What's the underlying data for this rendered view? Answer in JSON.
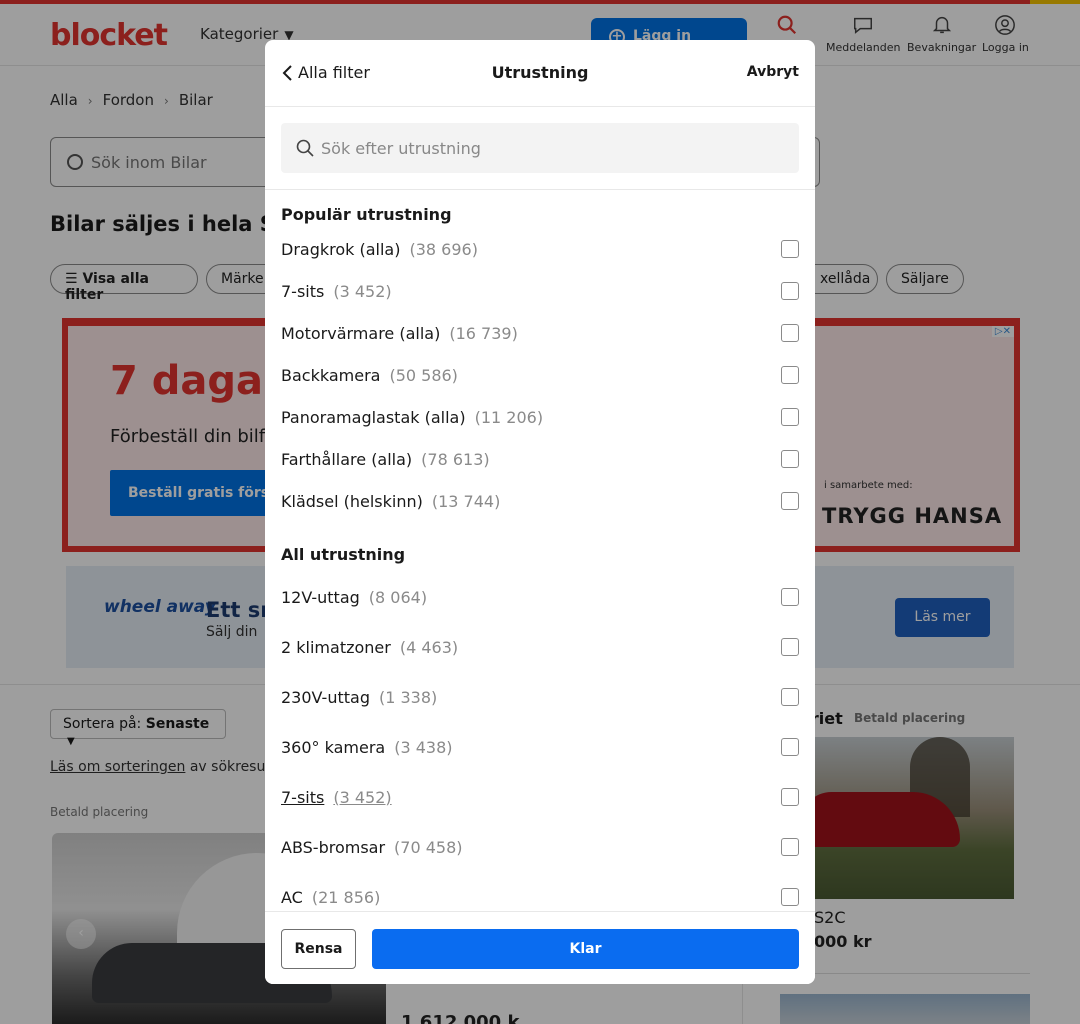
{
  "background": {
    "logo": "blocket",
    "nav": {
      "categories": "Kategorier",
      "post_ad": "Lägg in annons"
    },
    "header_icons": [
      {
        "icon": "search-icon",
        "label": ""
      },
      {
        "icon": "chat-icon",
        "label": "Meddelanden"
      },
      {
        "icon": "bell-icon",
        "label": "Bevakningar"
      },
      {
        "icon": "user-icon",
        "label": "Logga in"
      }
    ],
    "breadcrumbs": [
      "Alla",
      "Fordon",
      "Bilar"
    ],
    "search_placeholder": "Sök inom Bilar",
    "page_title": "Bilar säljes i hela Sveri",
    "chips": {
      "all_filters": "Visa alla filter",
      "brand": "Märke",
      "gearbox": "xellåda",
      "seller": "Säljare"
    },
    "ad1": {
      "headline": "7 dagar",
      "sub": "Förbeställ din bilfö",
      "cta": "Beställ gratis förså",
      "partner_label": "i samarbete med:",
      "partner_brand": "TRYGG HANSA"
    },
    "ad2": {
      "brand": "wheel away",
      "headline": "Ett sn",
      "sub": "Sälj din",
      "cta": "Läs mer"
    },
    "sort": {
      "prefix": "Sortera på:",
      "value": "Senaste"
    },
    "sort_info": {
      "link": "Läs om sorteringen",
      "rest": "av sökresulta"
    },
    "paid_label": "Betald placering",
    "price_partial": "1 612 000 k",
    "right": {
      "heading": "eriet",
      "paid": "Betald placering",
      "model": "S2C",
      "price": "000 kr"
    }
  },
  "modal": {
    "back_label": "Alla filter",
    "title": "Utrustning",
    "cancel_label": "Avbryt",
    "search_placeholder": "Sök efter utrustning",
    "popular_heading": "Populär utrustning",
    "popular": [
      {
        "label": "Dragkrok (alla)",
        "count": "(38 696)",
        "checked": false
      },
      {
        "label": "7-sits",
        "count": "(3 452)",
        "checked": false
      },
      {
        "label": "Motorvärmare (alla)",
        "count": "(16 739)",
        "checked": false
      },
      {
        "label": "Backkamera",
        "count": "(50 586)",
        "checked": false
      },
      {
        "label": "Panoramaglastak (alla)",
        "count": "(11 206)",
        "checked": false
      },
      {
        "label": "Farthållare (alla)",
        "count": "(78 613)",
        "checked": false
      },
      {
        "label": "Klädsel (helskinn)",
        "count": "(13 744)",
        "checked": false
      }
    ],
    "all_heading": "All utrustning",
    "all": [
      {
        "label": "12V-uttag",
        "count": "(8 064)",
        "checked": false
      },
      {
        "label": "2 klimatzoner",
        "count": "(4 463)",
        "checked": false
      },
      {
        "label": "230V-uttag",
        "count": "(1 338)",
        "checked": false
      },
      {
        "label": "360° kamera",
        "count": "(3 438)",
        "checked": false
      },
      {
        "label": "7-sits",
        "count": "(3 452)",
        "checked": false,
        "hovered": true
      },
      {
        "label": "ABS-bromsar",
        "count": "(70 458)",
        "checked": false
      },
      {
        "label": "AC",
        "count": "(21 856)",
        "checked": false
      }
    ],
    "reset_label": "Rensa",
    "done_label": "Klar"
  }
}
